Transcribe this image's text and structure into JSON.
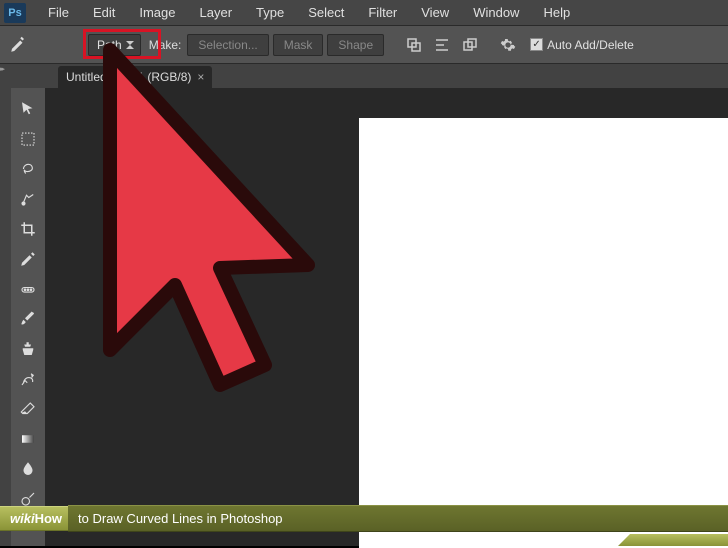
{
  "menubar": {
    "items": [
      "File",
      "Edit",
      "Image",
      "Layer",
      "Type",
      "Select",
      "Filter",
      "View",
      "Window",
      "Help"
    ]
  },
  "options": {
    "dropdown_value": "Path",
    "make_label": "Make:",
    "selection_btn": "Selection...",
    "mask_btn": "Mask",
    "shape_btn": "Shape",
    "auto_add_label": "Auto Add/Delete"
  },
  "document_tab": {
    "title": "Untitled-1",
    "zoom_suffix": ".7% (RGB/8)"
  },
  "caption": {
    "brand": "wikiHow",
    "brand_prefix": "wiki",
    "brand_suffix": "How",
    "title": " to Draw Curved Lines in Photoshop"
  },
  "tools": [
    "move-tool",
    "marquee-tool",
    "lasso-tool",
    "quick-select-tool",
    "crop-tool",
    "eyedropper-tool",
    "healing-brush-tool",
    "brush-tool",
    "clone-stamp-tool",
    "history-brush-tool",
    "eraser-tool",
    "gradient-tool",
    "blur-tool",
    "dodge-tool"
  ]
}
